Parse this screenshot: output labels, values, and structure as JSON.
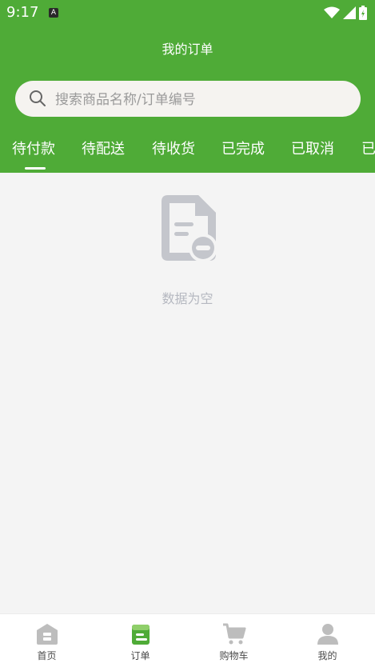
{
  "status": {
    "time": "9:17",
    "notification_badge": "A"
  },
  "header": {
    "title": "我的订单"
  },
  "search": {
    "placeholder": "搜索商品名称/订单编号",
    "value": ""
  },
  "tabs": [
    {
      "label": "待付款",
      "active": true
    },
    {
      "label": "待配送"
    },
    {
      "label": "待收货"
    },
    {
      "label": "已完成"
    },
    {
      "label": "已取消"
    },
    {
      "label": "已"
    }
  ],
  "empty_state": {
    "icon": "empty-document-icon",
    "text": "数据为空"
  },
  "tabbar": [
    {
      "label": "首页",
      "icon": "home-icon"
    },
    {
      "label": "订单",
      "icon": "order-icon",
      "active": true
    },
    {
      "label": "购物车",
      "icon": "cart-icon"
    },
    {
      "label": "我的",
      "icon": "profile-icon"
    }
  ],
  "colors": {
    "brand": "#4fab37",
    "background": "#f4f4f4",
    "muted": "#c4c6cc"
  }
}
